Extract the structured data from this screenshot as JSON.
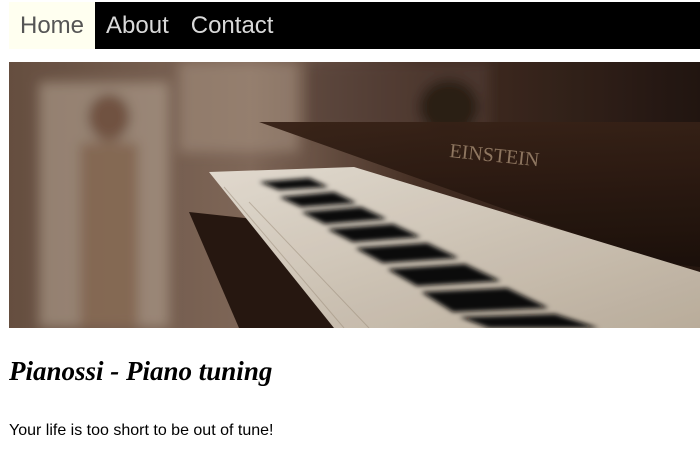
{
  "nav": {
    "items": [
      {
        "label": "Home",
        "active": true
      },
      {
        "label": "About",
        "active": false
      },
      {
        "label": "Contact",
        "active": false
      }
    ]
  },
  "hero": {
    "image": "piano-keyboard-photo",
    "brand_text": "EINSTEIN"
  },
  "main": {
    "title": "Pianossi - Piano tuning",
    "tagline": "Your life is too short to be out of tune!"
  },
  "colors": {
    "nav_background": "#000000",
    "nav_active_background": "#fffff0",
    "nav_active_text": "#555555",
    "nav_text": "#d9d9d9"
  }
}
